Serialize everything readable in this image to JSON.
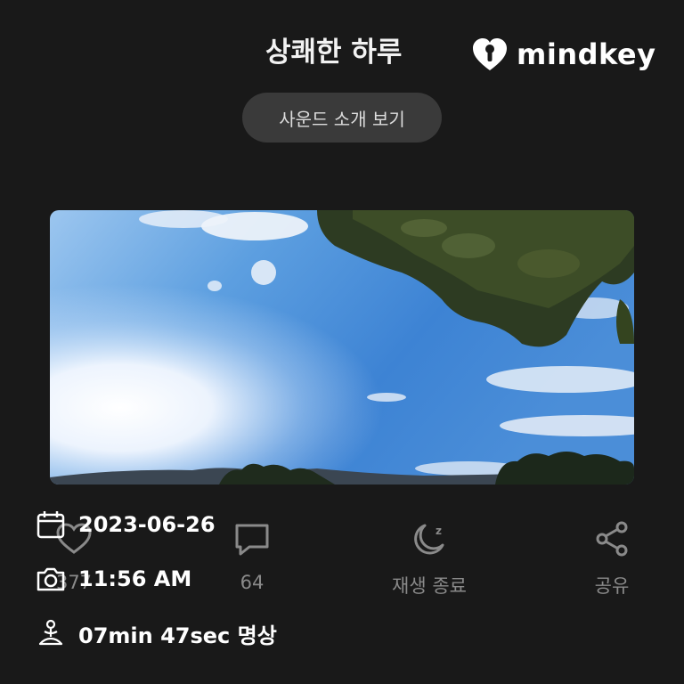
{
  "header": {
    "title": "상쾌한 하루",
    "brand": "mindkey"
  },
  "sound_button": {
    "label": "사운드 소개 보기"
  },
  "actions": [
    {
      "id": "like",
      "icon": "heart-icon",
      "label": "377"
    },
    {
      "id": "comment",
      "icon": "comment-icon",
      "label": "64"
    },
    {
      "id": "sleep",
      "icon": "moon-zz-icon",
      "label": "재생 종료"
    },
    {
      "id": "share",
      "icon": "share-icon",
      "label": "공유"
    }
  ],
  "info": {
    "date": {
      "icon": "calendar-icon",
      "text": "2023-06-26"
    },
    "time": {
      "icon": "camera-icon",
      "text": "11:56 AM"
    },
    "duration": {
      "icon": "meditation-icon",
      "text": "07min 47sec 명상"
    }
  }
}
